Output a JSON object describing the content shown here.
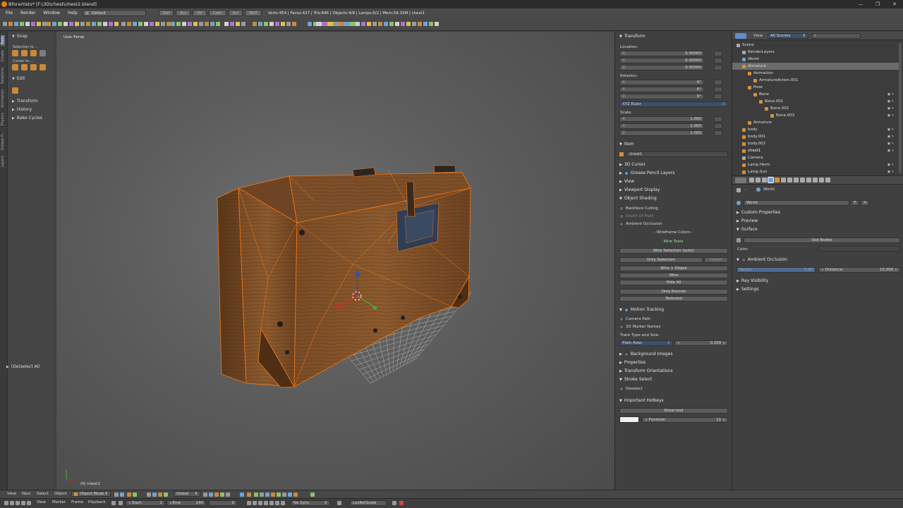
{
  "window": {
    "title": "Bforartists* [F:\\3D\\chest\\chest2.blend]",
    "controls": [
      "—",
      "❐",
      "✕"
    ]
  },
  "infobar": {
    "menus": [
      "File",
      "Render",
      "Window",
      "Help"
    ],
    "layout": "Default",
    "workspace_tabs": [
      "Def",
      "Ani",
      "UV",
      "Com",
      "Scr",
      "MoT"
    ],
    "stats": "Verts:454 | Faces:427 | Tris:846 | Objects:4/8 | Lamps:0/2 | Mem:56.33M | chest1"
  },
  "left_tabs": [
    "Tools",
    "Create",
    "Relations",
    "Animation",
    "Physics",
    "Grease P...",
    "Layers"
  ],
  "toolshelf": {
    "snap_header": "Snap",
    "selection_to": "Selection to ...",
    "cursor_to": "Cursor to ...",
    "edit_header": "Edit",
    "panels": [
      "Transform",
      "History",
      "Bake Cycles"
    ],
    "operator": "(De)select All"
  },
  "viewport": {
    "view_label": "User Persp",
    "object_label": "(0) chest1"
  },
  "npanel": {
    "transform_header": "Transform",
    "location_label": "Location:",
    "location": [
      {
        "axis": "X:",
        "value": "0.00000"
      },
      {
        "axis": "Y:",
        "value": "0.00000"
      },
      {
        "axis": "Z:",
        "value": "0.00000"
      }
    ],
    "rotation_label": "Rotation:",
    "rotation": [
      {
        "axis": "X:",
        "value": "0°"
      },
      {
        "axis": "Y:",
        "value": "0°"
      },
      {
        "axis": "Z:",
        "value": "0°"
      }
    ],
    "rotation_mode": "XYZ Euler",
    "scale_label": "Scale:",
    "scale": [
      {
        "axis": "X:",
        "value": "1.000"
      },
      {
        "axis": "Y:",
        "value": "1.000"
      },
      {
        "axis": "Z:",
        "value": "1.000"
      }
    ],
    "item_header": "Item",
    "item_name": "chest1",
    "cursor_header": "3D Cursor",
    "gp_layers": "Grease Pencil Layers",
    "view_header": "View",
    "viewport_display": "Viewport Display",
    "object_shading": "Object Shading",
    "backface_culling": "Backface Culling",
    "depth_of_field": "Depth Of Field",
    "ambient_occlusion": "Ambient Occlusion",
    "wireframe_colors": "- Wireframe Colors -",
    "wire_tools": "Wire Tools",
    "wire_selection": "Wire Selection (auto)",
    "only_selection": "Only Selection",
    "invert": "Invert",
    "wire_edges": "Wire + Edges",
    "wire": "Wire",
    "hide_all": "Hide All",
    "only_bounds": "Only Bounds",
    "textured": "Textured",
    "motion_tracking": "Motion Tracking",
    "camera_path": "Camera Path",
    "marker_names": "3D Marker Names",
    "track_type_size": "Track Type and Size:",
    "plain_axes": "Plain Axes",
    "track_size": "0.200",
    "background_images": "Background Images",
    "properties": "Properties",
    "transform_orientations": "Transform Orientations",
    "stroke_select": "Stroke Select",
    "deselect": "Deselect",
    "important_hotkeys": "Important Hotkeys",
    "show_text": "Show text",
    "fontsize_label": "Fontsize:",
    "fontsize": "11"
  },
  "outliner": {
    "view_menu": "View",
    "scenes_selector": "All Scenes",
    "search_placeholder": "",
    "items": [
      {
        "label": "Scene",
        "depth": 0
      },
      {
        "label": "RenderLayers",
        "depth": 1
      },
      {
        "label": "World",
        "depth": 1
      },
      {
        "label": "Armature",
        "depth": 1
      },
      {
        "label": "Animation",
        "depth": 2
      },
      {
        "label": "ArmatureAction.001",
        "depth": 3
      },
      {
        "label": "Pose",
        "depth": 2
      },
      {
        "label": "Bone",
        "depth": 3
      },
      {
        "label": "Bone.001",
        "depth": 4
      },
      {
        "label": "Bone.002",
        "depth": 5
      },
      {
        "label": "Bone.003",
        "depth": 6
      },
      {
        "label": "Armature",
        "depth": 2
      },
      {
        "label": "body",
        "depth": 1
      },
      {
        "label": "body.001",
        "depth": 1
      },
      {
        "label": "body.002",
        "depth": 1
      },
      {
        "label": "chest1",
        "depth": 1
      },
      {
        "label": "Camera",
        "depth": 1
      },
      {
        "label": "Lamp.Hemi",
        "depth": 1
      },
      {
        "label": "Lamp.Sun",
        "depth": 1
      }
    ]
  },
  "properties": {
    "context": "World",
    "world_name": "World",
    "fake_user": "F",
    "panels": [
      "Custom Properties",
      "Preview",
      "Surface"
    ],
    "use_nodes": "Use Nodes",
    "color_label": "Color:",
    "ambient_occlusion": "Ambient Occlusion",
    "factor_label": "Factor:",
    "factor_value": "1.00",
    "distance_label": "Distance:",
    "distance_value": "10.000",
    "ray_visibility": "Ray Visibility",
    "settings": "Settings"
  },
  "bottom": {
    "view3d_menus": [
      "View",
      "Navi",
      "Select",
      "Object"
    ],
    "mode": "Object Mode",
    "orientation": "Global",
    "timeline_menus": [
      "View",
      "Marker",
      "Frame",
      "Playback"
    ],
    "start_label": "Start:",
    "start_value": "1",
    "end_label": "End:",
    "end_value": "140",
    "current_frame": "0",
    "sync": "No Sync",
    "keying_set": "LocRotScale"
  },
  "colors": {
    "accent_blue": "#5d8ec6",
    "selection_orange": "#ff7a12",
    "outliner_highlight": "#6b6b6b"
  }
}
